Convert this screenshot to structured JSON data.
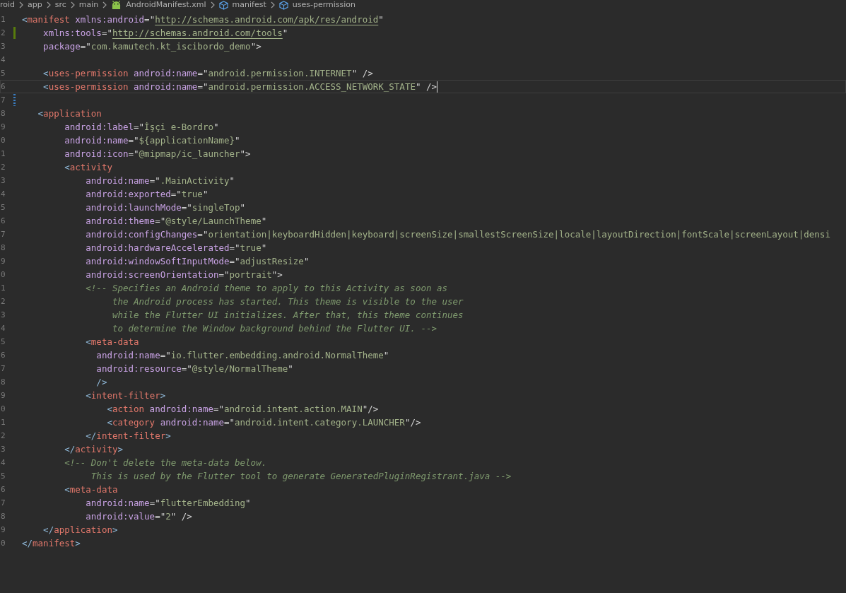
{
  "breadcrumb": [
    {
      "text": "roid",
      "kind": "folder"
    },
    {
      "text": "app",
      "kind": "folder"
    },
    {
      "text": "src",
      "kind": "folder"
    },
    {
      "text": "main",
      "kind": "folder"
    },
    {
      "text": "AndroidManifest.xml",
      "kind": "android"
    },
    {
      "text": "manifest",
      "kind": "element"
    },
    {
      "text": "uses-permission",
      "kind": "element"
    }
  ],
  "editor": {
    "lines": [
      {
        "n": "1",
        "tokens": [
          {
            "kind": "punct",
            "text": "<"
          },
          {
            "kind": "tag",
            "text": "manifest"
          },
          {
            "kind": "attr",
            "text": " xmlns:android"
          },
          {
            "kind": "quote",
            "text": "=\""
          },
          {
            "kind": "url",
            "text": "http://schemas.android.com/apk/res/android"
          },
          {
            "kind": "quote",
            "text": "\""
          }
        ]
      },
      {
        "n": "2",
        "added": true,
        "tokens": [
          {
            "kind": "attr",
            "text": "    xmlns:tools"
          },
          {
            "kind": "quote",
            "text": "=\""
          },
          {
            "kind": "url",
            "text": "http://schemas.android.com/tools"
          },
          {
            "kind": "quote",
            "text": "\""
          }
        ]
      },
      {
        "n": "3",
        "tokens": [
          {
            "kind": "attr",
            "text": "    package"
          },
          {
            "kind": "quote",
            "text": "=\""
          },
          {
            "kind": "string",
            "text": "com.kamutech.kt_iscibordo_demo"
          },
          {
            "kind": "quote",
            "text": "\">"
          }
        ]
      },
      {
        "n": "4"
      },
      {
        "n": "5",
        "tokens": [
          {
            "kind": "punct",
            "text": "    <"
          },
          {
            "kind": "tag",
            "text": "uses-permission"
          },
          {
            "kind": "attr",
            "text": " android:name"
          },
          {
            "kind": "quote",
            "text": "=\""
          },
          {
            "kind": "string",
            "text": "android.permission.INTERNET"
          },
          {
            "kind": "quote",
            "text": "\" />"
          }
        ]
      },
      {
        "n": "6",
        "current": true,
        "tokens": [
          {
            "kind": "punct",
            "text": "    <"
          },
          {
            "kind": "tag",
            "text": "uses-permission"
          },
          {
            "kind": "attr",
            "text": " android:name"
          },
          {
            "kind": "quote",
            "text": "=\""
          },
          {
            "kind": "string",
            "text": "android.permission.ACCESS_NETWORK_STATE"
          },
          {
            "kind": "quote",
            "text": "\" />"
          }
        ]
      },
      {
        "n": "7",
        "modified": true
      },
      {
        "n": "8",
        "tokens": [
          {
            "kind": "punct",
            "text": "   <"
          },
          {
            "kind": "tag",
            "text": "application"
          }
        ]
      },
      {
        "n": "9",
        "tokens": [
          {
            "kind": "attr",
            "text": "        android:label"
          },
          {
            "kind": "quote",
            "text": "=\""
          },
          {
            "kind": "string",
            "text": "İşçi e-Bordro"
          },
          {
            "kind": "quote",
            "text": "\""
          }
        ]
      },
      {
        "n": "0",
        "tokens": [
          {
            "kind": "attr",
            "text": "        android:name"
          },
          {
            "kind": "quote",
            "text": "=\""
          },
          {
            "kind": "string",
            "text": "${applicationName}"
          },
          {
            "kind": "quote",
            "text": "\""
          }
        ]
      },
      {
        "n": "1",
        "tokens": [
          {
            "kind": "attr",
            "text": "        android:icon"
          },
          {
            "kind": "quote",
            "text": "=\""
          },
          {
            "kind": "string",
            "text": "@mipmap/ic_launcher"
          },
          {
            "kind": "quote",
            "text": "\">"
          }
        ]
      },
      {
        "n": "2",
        "tokens": [
          {
            "kind": "punct",
            "text": "        <"
          },
          {
            "kind": "tag",
            "text": "activity"
          }
        ]
      },
      {
        "n": "3",
        "tokens": [
          {
            "kind": "attr",
            "text": "            android:name"
          },
          {
            "kind": "quote",
            "text": "=\""
          },
          {
            "kind": "string",
            "text": ".MainActivity"
          },
          {
            "kind": "quote",
            "text": "\""
          }
        ]
      },
      {
        "n": "4",
        "tokens": [
          {
            "kind": "attr",
            "text": "            android:exported"
          },
          {
            "kind": "quote",
            "text": "=\""
          },
          {
            "kind": "string",
            "text": "true"
          },
          {
            "kind": "quote",
            "text": "\""
          }
        ]
      },
      {
        "n": "5",
        "tokens": [
          {
            "kind": "attr",
            "text": "            android:launchMode"
          },
          {
            "kind": "quote",
            "text": "=\""
          },
          {
            "kind": "string",
            "text": "singleTop"
          },
          {
            "kind": "quote",
            "text": "\""
          }
        ]
      },
      {
        "n": "6",
        "tokens": [
          {
            "kind": "attr",
            "text": "            android:theme"
          },
          {
            "kind": "quote",
            "text": "=\""
          },
          {
            "kind": "string",
            "text": "@style/LaunchTheme"
          },
          {
            "kind": "quote",
            "text": "\""
          }
        ]
      },
      {
        "n": "7",
        "tokens": [
          {
            "kind": "attr",
            "text": "            android:configChanges"
          },
          {
            "kind": "quote",
            "text": "=\""
          },
          {
            "kind": "string",
            "text": "orientation|keyboardHidden|keyboard|screenSize|smallestScreenSize|locale|layoutDirection|fontScale|screenLayout|densi"
          }
        ]
      },
      {
        "n": "8",
        "tokens": [
          {
            "kind": "attr",
            "text": "            android:hardwareAccelerated"
          },
          {
            "kind": "quote",
            "text": "=\""
          },
          {
            "kind": "string",
            "text": "true"
          },
          {
            "kind": "quote",
            "text": "\""
          }
        ]
      },
      {
        "n": "9",
        "tokens": [
          {
            "kind": "attr",
            "text": "            android:windowSoftInputMode"
          },
          {
            "kind": "quote",
            "text": "=\""
          },
          {
            "kind": "string",
            "text": "adjustResize"
          },
          {
            "kind": "quote",
            "text": "\""
          }
        ]
      },
      {
        "n": "0",
        "tokens": [
          {
            "kind": "attr",
            "text": "            android:screenOrientation"
          },
          {
            "kind": "quote",
            "text": "=\""
          },
          {
            "kind": "string",
            "text": "portrait"
          },
          {
            "kind": "quote",
            "text": "\">"
          }
        ]
      },
      {
        "n": "1",
        "tokens": [
          {
            "kind": "comment",
            "text": "            <!-- Specifies an Android theme to apply to this Activity as soon as"
          }
        ]
      },
      {
        "n": "2",
        "tokens": [
          {
            "kind": "comment",
            "text": "                 the Android process has started. This theme is visible to the user"
          }
        ]
      },
      {
        "n": "3",
        "tokens": [
          {
            "kind": "comment",
            "text": "                 while the Flutter UI initializes. After that, this theme continues"
          }
        ]
      },
      {
        "n": "4",
        "tokens": [
          {
            "kind": "comment",
            "text": "                 to determine the Window background behind the Flutter UI. -->"
          }
        ]
      },
      {
        "n": "5",
        "tokens": [
          {
            "kind": "punct",
            "text": "            <"
          },
          {
            "kind": "tag",
            "text": "meta-data"
          }
        ]
      },
      {
        "n": "6",
        "tokens": [
          {
            "kind": "attr",
            "text": "              android:name"
          },
          {
            "kind": "quote",
            "text": "=\""
          },
          {
            "kind": "string",
            "text": "io.flutter.embedding.android.NormalTheme"
          },
          {
            "kind": "quote",
            "text": "\""
          }
        ]
      },
      {
        "n": "7",
        "tokens": [
          {
            "kind": "attr",
            "text": "              android:resource"
          },
          {
            "kind": "quote",
            "text": "=\""
          },
          {
            "kind": "string",
            "text": "@style/NormalTheme"
          },
          {
            "kind": "quote",
            "text": "\""
          }
        ]
      },
      {
        "n": "8",
        "tokens": [
          {
            "kind": "punct",
            "text": "              />"
          }
        ]
      },
      {
        "n": "9",
        "tokens": [
          {
            "kind": "punct",
            "text": "            <"
          },
          {
            "kind": "tag",
            "text": "intent-filter"
          },
          {
            "kind": "punct",
            "text": ">"
          }
        ]
      },
      {
        "n": "0",
        "tokens": [
          {
            "kind": "punct",
            "text": "                <"
          },
          {
            "kind": "tag",
            "text": "action"
          },
          {
            "kind": "attr",
            "text": " android:name"
          },
          {
            "kind": "quote",
            "text": "=\""
          },
          {
            "kind": "string",
            "text": "android.intent.action.MAIN"
          },
          {
            "kind": "quote",
            "text": "\"/>"
          }
        ]
      },
      {
        "n": "1",
        "tokens": [
          {
            "kind": "punct",
            "text": "                <"
          },
          {
            "kind": "tag",
            "text": "category"
          },
          {
            "kind": "attr",
            "text": " android:name"
          },
          {
            "kind": "quote",
            "text": "=\""
          },
          {
            "kind": "string",
            "text": "android.intent.category.LAUNCHER"
          },
          {
            "kind": "quote",
            "text": "\"/>"
          }
        ]
      },
      {
        "n": "2",
        "tokens": [
          {
            "kind": "punct",
            "text": "            </"
          },
          {
            "kind": "tag",
            "text": "intent-filter"
          },
          {
            "kind": "punct",
            "text": ">"
          }
        ]
      },
      {
        "n": "3",
        "tokens": [
          {
            "kind": "punct",
            "text": "        </"
          },
          {
            "kind": "tag",
            "text": "activity"
          },
          {
            "kind": "punct",
            "text": ">"
          }
        ]
      },
      {
        "n": "4",
        "tokens": [
          {
            "kind": "comment",
            "text": "        <!-- Don't delete the meta-data below."
          }
        ]
      },
      {
        "n": "5",
        "tokens": [
          {
            "kind": "comment",
            "text": "             This is used by the Flutter tool to generate GeneratedPluginRegistrant.java -->"
          }
        ]
      },
      {
        "n": "6",
        "tokens": [
          {
            "kind": "punct",
            "text": "        <"
          },
          {
            "kind": "tag",
            "text": "meta-data"
          }
        ]
      },
      {
        "n": "7",
        "tokens": [
          {
            "kind": "attr",
            "text": "            android:name"
          },
          {
            "kind": "quote",
            "text": "=\""
          },
          {
            "kind": "string",
            "text": "flutterEmbedding"
          },
          {
            "kind": "quote",
            "text": "\""
          }
        ]
      },
      {
        "n": "8",
        "tokens": [
          {
            "kind": "attr",
            "text": "            android:value"
          },
          {
            "kind": "quote",
            "text": "=\""
          },
          {
            "kind": "string",
            "text": "2"
          },
          {
            "kind": "quote",
            "text": "\" />"
          }
        ]
      },
      {
        "n": "9",
        "tokens": [
          {
            "kind": "punct",
            "text": "    </"
          },
          {
            "kind": "tag",
            "text": "application"
          },
          {
            "kind": "punct",
            "text": ">"
          }
        ]
      },
      {
        "n": "0",
        "tokens": [
          {
            "kind": "punct",
            "text": "</"
          },
          {
            "kind": "tag",
            "text": "manifest"
          },
          {
            "kind": "punct",
            "text": ">"
          }
        ]
      }
    ]
  }
}
